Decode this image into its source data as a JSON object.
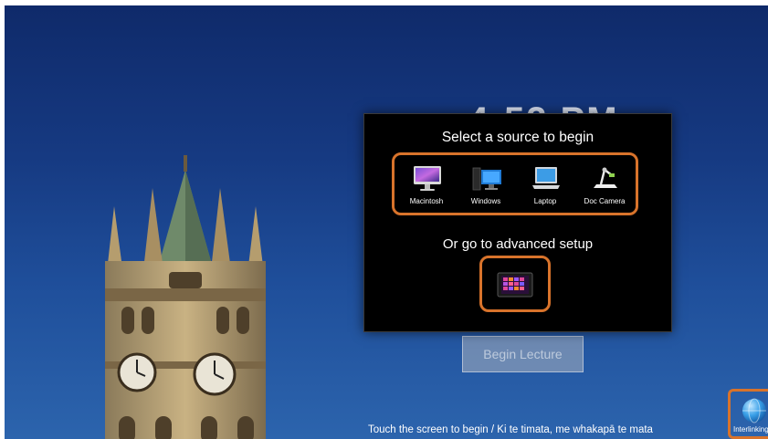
{
  "background_clock": "4:52 PM",
  "dialog": {
    "title": "Select a source to begin",
    "sources": [
      {
        "label": "Macintosh",
        "icon": "imac-icon"
      },
      {
        "label": "Windows",
        "icon": "windows-pc-icon"
      },
      {
        "label": "Laptop",
        "icon": "laptop-icon"
      },
      {
        "label": "Doc Camera",
        "icon": "doc-camera-icon"
      }
    ],
    "advanced_title": "Or go to advanced setup",
    "advanced_icon": "tablet-icon"
  },
  "begin_button": "Begin Lecture",
  "touch_hint": "Touch the screen to begin / Ki te timata, me whakapā te mata",
  "interlink": {
    "label": "Interlinking",
    "icon": "globe-icon"
  },
  "colors": {
    "highlight": "#d8732b",
    "dialog_bg": "#000000",
    "sky": "#1f4f9b"
  }
}
